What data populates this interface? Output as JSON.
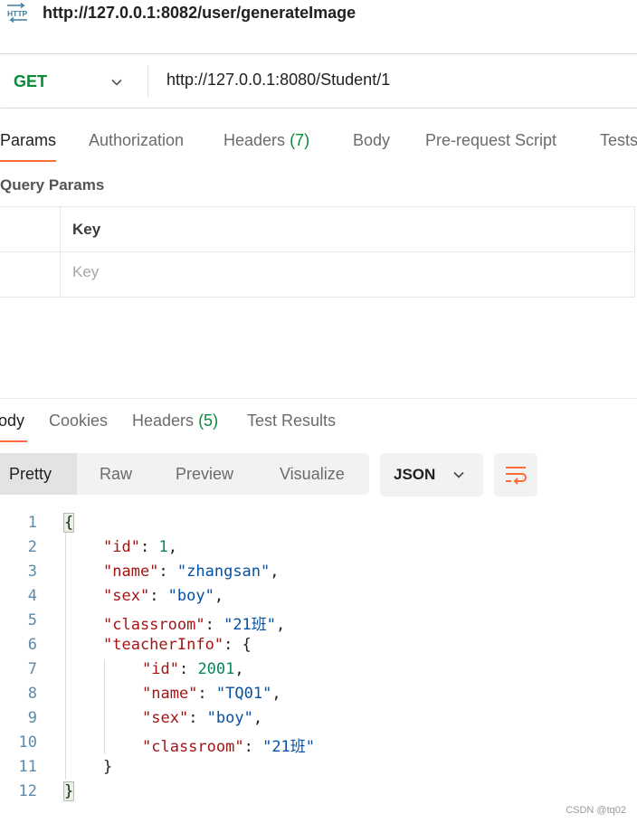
{
  "header": {
    "icon_text": "HTTP",
    "title": "http://127.0.0.1:8082/user/generateImage"
  },
  "request": {
    "method": "GET",
    "url": "http://127.0.0.1:8080/Student/1"
  },
  "request_tabs": [
    {
      "label": "Params"
    },
    {
      "label": "Authorization"
    },
    {
      "label": "Headers",
      "count": "(7)"
    },
    {
      "label": "Body"
    },
    {
      "label": "Pre-request Script"
    },
    {
      "label": "Tests"
    }
  ],
  "query_params": {
    "heading": "Query Params",
    "key_header": "Key",
    "key_placeholder": "Key"
  },
  "response_tabs": [
    {
      "label": "Body"
    },
    {
      "label": "Cookies"
    },
    {
      "label": "Headers",
      "count": "(5)"
    },
    {
      "label": "Test Results"
    }
  ],
  "view_modes": [
    {
      "label": "Pretty"
    },
    {
      "label": "Raw"
    },
    {
      "label": "Preview"
    },
    {
      "label": "Visualize"
    }
  ],
  "format": "JSON",
  "response_body": {
    "line_numbers": [
      "1",
      "2",
      "3",
      "4",
      "5",
      "6",
      "7",
      "8",
      "9",
      "10",
      "11",
      "12"
    ],
    "root_open": "{",
    "root_close": "}",
    "inner_close": "}",
    "fields": [
      {
        "key": "\"id\"",
        "value": "1",
        "punct": ","
      },
      {
        "key": "\"name\"",
        "value": "\"zhangsan\"",
        "punct": ","
      },
      {
        "key": "\"sex\"",
        "value": "\"boy\"",
        "punct": ","
      },
      {
        "key": "\"classroom\"",
        "value": "\"21班\"",
        "punct": ","
      },
      {
        "key": "\"teacherInfo\"",
        "value": "{",
        "punct": ""
      }
    ],
    "teacher_fields": [
      {
        "key": "\"id\"",
        "value": "2001",
        "punct": ","
      },
      {
        "key": "\"name\"",
        "value": "\"TQ01\"",
        "punct": ","
      },
      {
        "key": "\"sex\"",
        "value": "\"boy\"",
        "punct": ","
      },
      {
        "key": "\"classroom\"",
        "value": "\"21班\"",
        "punct": ""
      }
    ]
  },
  "watermark": "CSDN @tq02",
  "colors": {
    "accent": "#ff6c37",
    "method_green": "#0b8a3a",
    "json_key": "#a31515",
    "json_string": "#0451a5",
    "json_number": "#098658"
  }
}
